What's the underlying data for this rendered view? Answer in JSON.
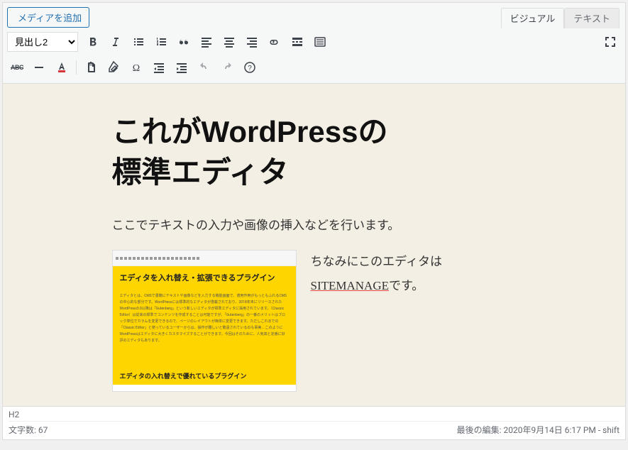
{
  "topBar": {
    "addMediaLabel": "メディアを追加",
    "tabs": {
      "visual": "ビジュアル",
      "text": "テキスト"
    }
  },
  "toolbar": {
    "formatSelect": "見出し2",
    "row1": {
      "bold": "bold",
      "italic": "italic",
      "ul": "bulleted-list",
      "ol": "numbered-list",
      "quote": "blockquote",
      "alignLeft": "align-left",
      "alignCenter": "align-center",
      "alignRight": "align-right",
      "link": "insert-link",
      "more": "read-more",
      "toolbarToggle": "toolbar-toggle",
      "fullscreen": "fullscreen"
    },
    "row2": {
      "strike": "strikethrough",
      "hr": "horizontal-rule",
      "textcolor": "text-color",
      "paste": "paste-as-text",
      "clear": "clear-formatting",
      "special": "special-character",
      "outdent": "outdent",
      "indent": "indent",
      "undo": "undo",
      "redo": "redo",
      "help": "help"
    },
    "abcLabel": "ABC"
  },
  "content": {
    "heading": "これがWordPressの\n標準エディタ",
    "paragraph1": "ここでテキストの入力や画像の挿入などを行います。",
    "embeddedImage": {
      "headerText": "エディタを入れ替え・拡張できるプラグイン",
      "bodyFiller": "エディタとは、CMSで書籍にテキストや画像などを入力する機能画面で、適用作用がもっともふれるCMSの中心的な部分です。WordPressには標準的なエディタが搭載されており、2018年末にリリースされたWordPress5.0以降は「Gutenberg」という新しいエディタが標準エディタに採用されています。（Classic Editor）は従来の標準でコンテンツを作成することは可能ですが、「Gutenberg」の一番のメリットはブロック単位でカラムを変更できるので、ページのレイアウトが簡単に変更できます。ただしこれまでの「Classic Editor」と使っているユーザーからは、操作が難しいと敬遠されているのも事実... このようにWordPressはエディタに大きくカスタマイズすることができます。今回はそのために、人気高と定番に好評のエディタもあります。",
      "footerText": "エディタの入れ替えで優れているプラグイン"
    },
    "sideParagraph": {
      "line1": "ちなみにこのエディタは",
      "underlined": "SITEMANAGE",
      "tail": "です。"
    }
  },
  "statusBar": {
    "path": "H2",
    "wordCountLabel": "文字数: ",
    "wordCount": "67",
    "lastEditLabel": "最後の編集: ",
    "lastEditDate": "2020年9月14日 6:17 PM",
    "lastEditUser": " - shift"
  }
}
